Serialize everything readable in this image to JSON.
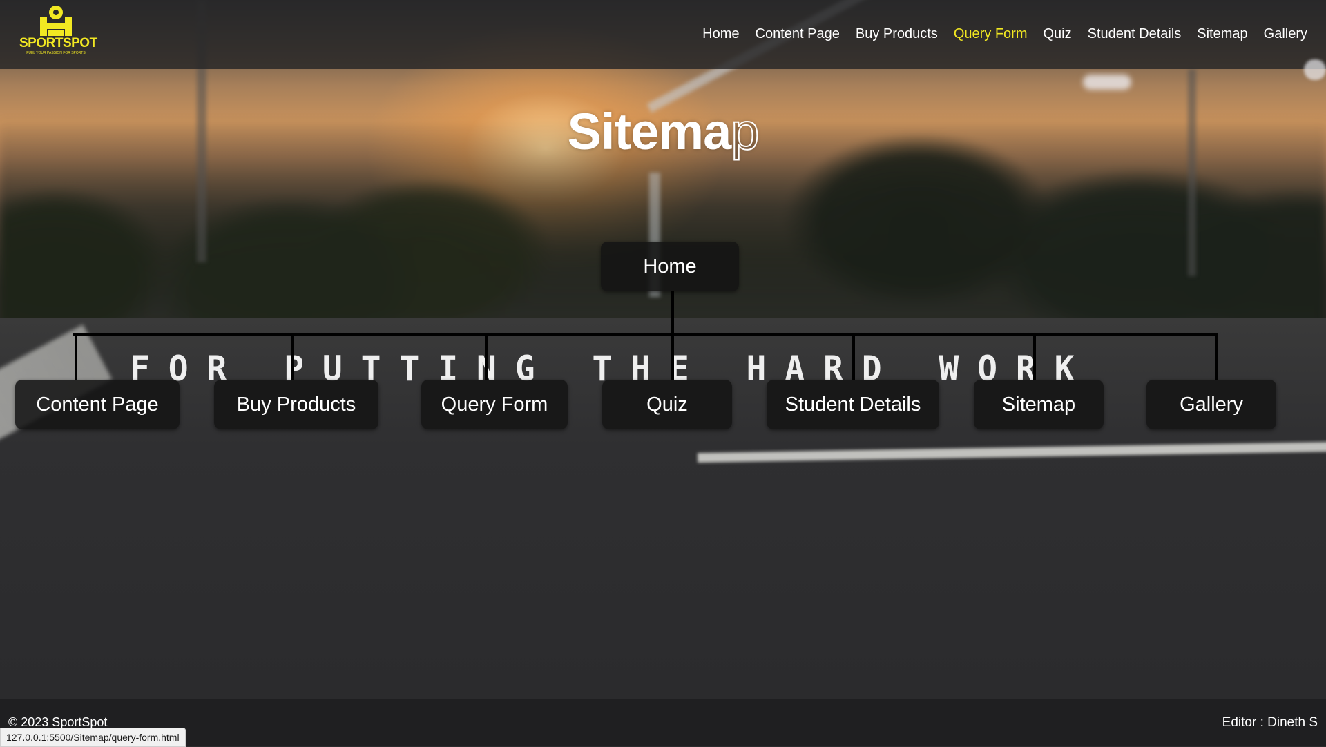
{
  "brand": {
    "name": "SPORTSPOT",
    "tagline": "FUEL YOUR PASSION FOR SPORTS",
    "color": "#f2e822"
  },
  "nav": {
    "items": [
      "Home",
      "Content Page",
      "Buy Products",
      "Query Form",
      "Quiz",
      "Student Details",
      "Sitemap",
      "Gallery"
    ],
    "active": "Query Form"
  },
  "title": {
    "main": "Sitema",
    "outlined": "p"
  },
  "sitemap": {
    "root": "Home",
    "children": [
      "Content Page",
      "Buy Products",
      "Query Form",
      "Quiz",
      "Student Details",
      "Sitemap",
      "Gallery"
    ]
  },
  "motto": "FOR PUTTING THE HARD WORK",
  "footer": {
    "copyright": "© 2023 SportSpot",
    "editor": "Editor : Dineth S"
  },
  "status_url": "127.0.0.1:5500/Sitemap/query-form.html"
}
